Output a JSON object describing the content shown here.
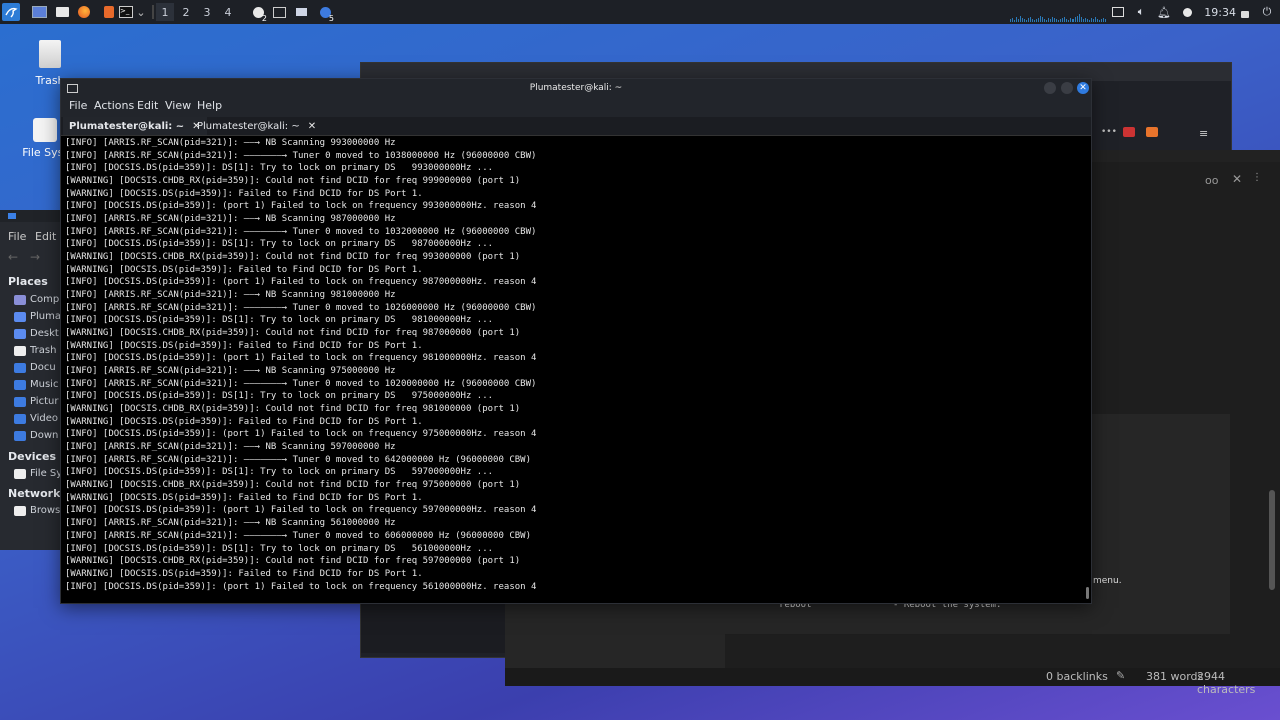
{
  "panel": {
    "workspaces": [
      "1",
      "2",
      "3",
      "4"
    ],
    "clock": "19:34",
    "badges": [
      "2",
      "5"
    ]
  },
  "desktop": {
    "trash_label": "Trash",
    "filesystem_label": "File Syst"
  },
  "file_manager": {
    "menu": [
      "File",
      "Edit"
    ],
    "places_header": "Places",
    "places": [
      "Comp",
      "Pluma",
      "Deskt",
      "Trash",
      "Docu",
      "Music",
      "Pictur",
      "Video",
      "Down"
    ],
    "devices_header": "Devices",
    "devices": [
      "File Sy"
    ],
    "network_header": "Network",
    "network": [
      "Brows"
    ]
  },
  "notes": {
    "snippet_reboot": "reboot",
    "snippet_desc": "- Reboot the system.",
    "snippet_menu": "menu.",
    "backlinks": "0 backlinks",
    "words": "381 words",
    "characters": "2944 characters"
  },
  "terminal": {
    "title": "Plumatester@kali: ~",
    "menus": [
      "File",
      "Actions",
      "Edit",
      "View",
      "Help"
    ],
    "tabs": [
      "Plumatester@kali: ~",
      "Plumatester@kali: ~"
    ],
    "lines": [
      "[INFO] [ARRIS.RF_SCAN(pid=321)]: ——→ NB Scanning 993000000 Hz",
      "[INFO] [ARRIS.RF_SCAN(pid=321)]: ———————→ Tuner 0 moved to 1038000000 Hz (96000000 CBW)",
      "[INFO] [DOCSIS.DS(pid=359)]: DS[1]: Try to lock on primary DS   993000000Hz ...",
      "[WARNING] [DOCSIS.CHDB_RX(pid=359)]: Could not find DCID for freq 999000000 (port 1)",
      "[WARNING] [DOCSIS.DS(pid=359)]: Failed to Find DCID for DS Port 1.",
      "[INFO] [DOCSIS.DS(pid=359)]: (port 1) Failed to lock on frequency 993000000Hz. reason 4",
      "[INFO] [ARRIS.RF_SCAN(pid=321)]: ——→ NB Scanning 987000000 Hz",
      "[INFO] [ARRIS.RF_SCAN(pid=321)]: ———————→ Tuner 0 moved to 1032000000 Hz (96000000 CBW)",
      "[INFO] [DOCSIS.DS(pid=359)]: DS[1]: Try to lock on primary DS   987000000Hz ...",
      "[WARNING] [DOCSIS.CHDB_RX(pid=359)]: Could not find DCID for freq 993000000 (port 1)",
      "[WARNING] [DOCSIS.DS(pid=359)]: Failed to Find DCID for DS Port 1.",
      "[INFO] [DOCSIS.DS(pid=359)]: (port 1) Failed to lock on frequency 987000000Hz. reason 4",
      "[INFO] [ARRIS.RF_SCAN(pid=321)]: ——→ NB Scanning 981000000 Hz",
      "[INFO] [ARRIS.RF_SCAN(pid=321)]: ———————→ Tuner 0 moved to 1026000000 Hz (96000000 CBW)",
      "[INFO] [DOCSIS.DS(pid=359)]: DS[1]: Try to lock on primary DS   981000000Hz ...",
      "[WARNING] [DOCSIS.CHDB_RX(pid=359)]: Could not find DCID for freq 987000000 (port 1)",
      "[WARNING] [DOCSIS.DS(pid=359)]: Failed to Find DCID for DS Port 1.",
      "[INFO] [DOCSIS.DS(pid=359)]: (port 1) Failed to lock on frequency 981000000Hz. reason 4",
      "[INFO] [ARRIS.RF_SCAN(pid=321)]: ——→ NB Scanning 975000000 Hz",
      "[INFO] [ARRIS.RF_SCAN(pid=321)]: ———————→ Tuner 0 moved to 1020000000 Hz (96000000 CBW)",
      "[INFO] [DOCSIS.DS(pid=359)]: DS[1]: Try to lock on primary DS   975000000Hz ...",
      "[WARNING] [DOCSIS.CHDB_RX(pid=359)]: Could not find DCID for freq 981000000 (port 1)",
      "[WARNING] [DOCSIS.DS(pid=359)]: Failed to Find DCID for DS Port 1.",
      "[INFO] [DOCSIS.DS(pid=359)]: (port 1) Failed to lock on frequency 975000000Hz. reason 4",
      "[INFO] [ARRIS.RF_SCAN(pid=321)]: ——→ NB Scanning 597000000 Hz",
      "[INFO] [ARRIS.RF_SCAN(pid=321)]: ———————→ Tuner 0 moved to 642000000 Hz (96000000 CBW)",
      "[INFO] [DOCSIS.DS(pid=359)]: DS[1]: Try to lock on primary DS   597000000Hz ...",
      "[WARNING] [DOCSIS.CHDB_RX(pid=359)]: Could not find DCID for freq 975000000 (port 1)",
      "[WARNING] [DOCSIS.DS(pid=359)]: Failed to Find DCID for DS Port 1.",
      "[INFO] [DOCSIS.DS(pid=359)]: (port 1) Failed to lock on frequency 597000000Hz. reason 4",
      "[INFO] [ARRIS.RF_SCAN(pid=321)]: ——→ NB Scanning 561000000 Hz",
      "[INFO] [ARRIS.RF_SCAN(pid=321)]: ———————→ Tuner 0 moved to 606000000 Hz (96000000 CBW)",
      "[INFO] [DOCSIS.DS(pid=359)]: DS[1]: Try to lock on primary DS   561000000Hz ...",
      "[WARNING] [DOCSIS.CHDB_RX(pid=359)]: Could not find DCID for freq 597000000 (port 1)",
      "[WARNING] [DOCSIS.DS(pid=359)]: Failed to Find DCID for DS Port 1.",
      "[INFO] [DOCSIS.DS(pid=359)]: (port 1) Failed to lock on frequency 561000000Hz. reason 4"
    ]
  },
  "colors": {
    "terminal_bg": "#000000",
    "terminal_text": "#e6e6e6",
    "panel_bg": "#1d2026",
    "close_button": "#2f7be0",
    "accent_blue": "#3b80e6"
  }
}
